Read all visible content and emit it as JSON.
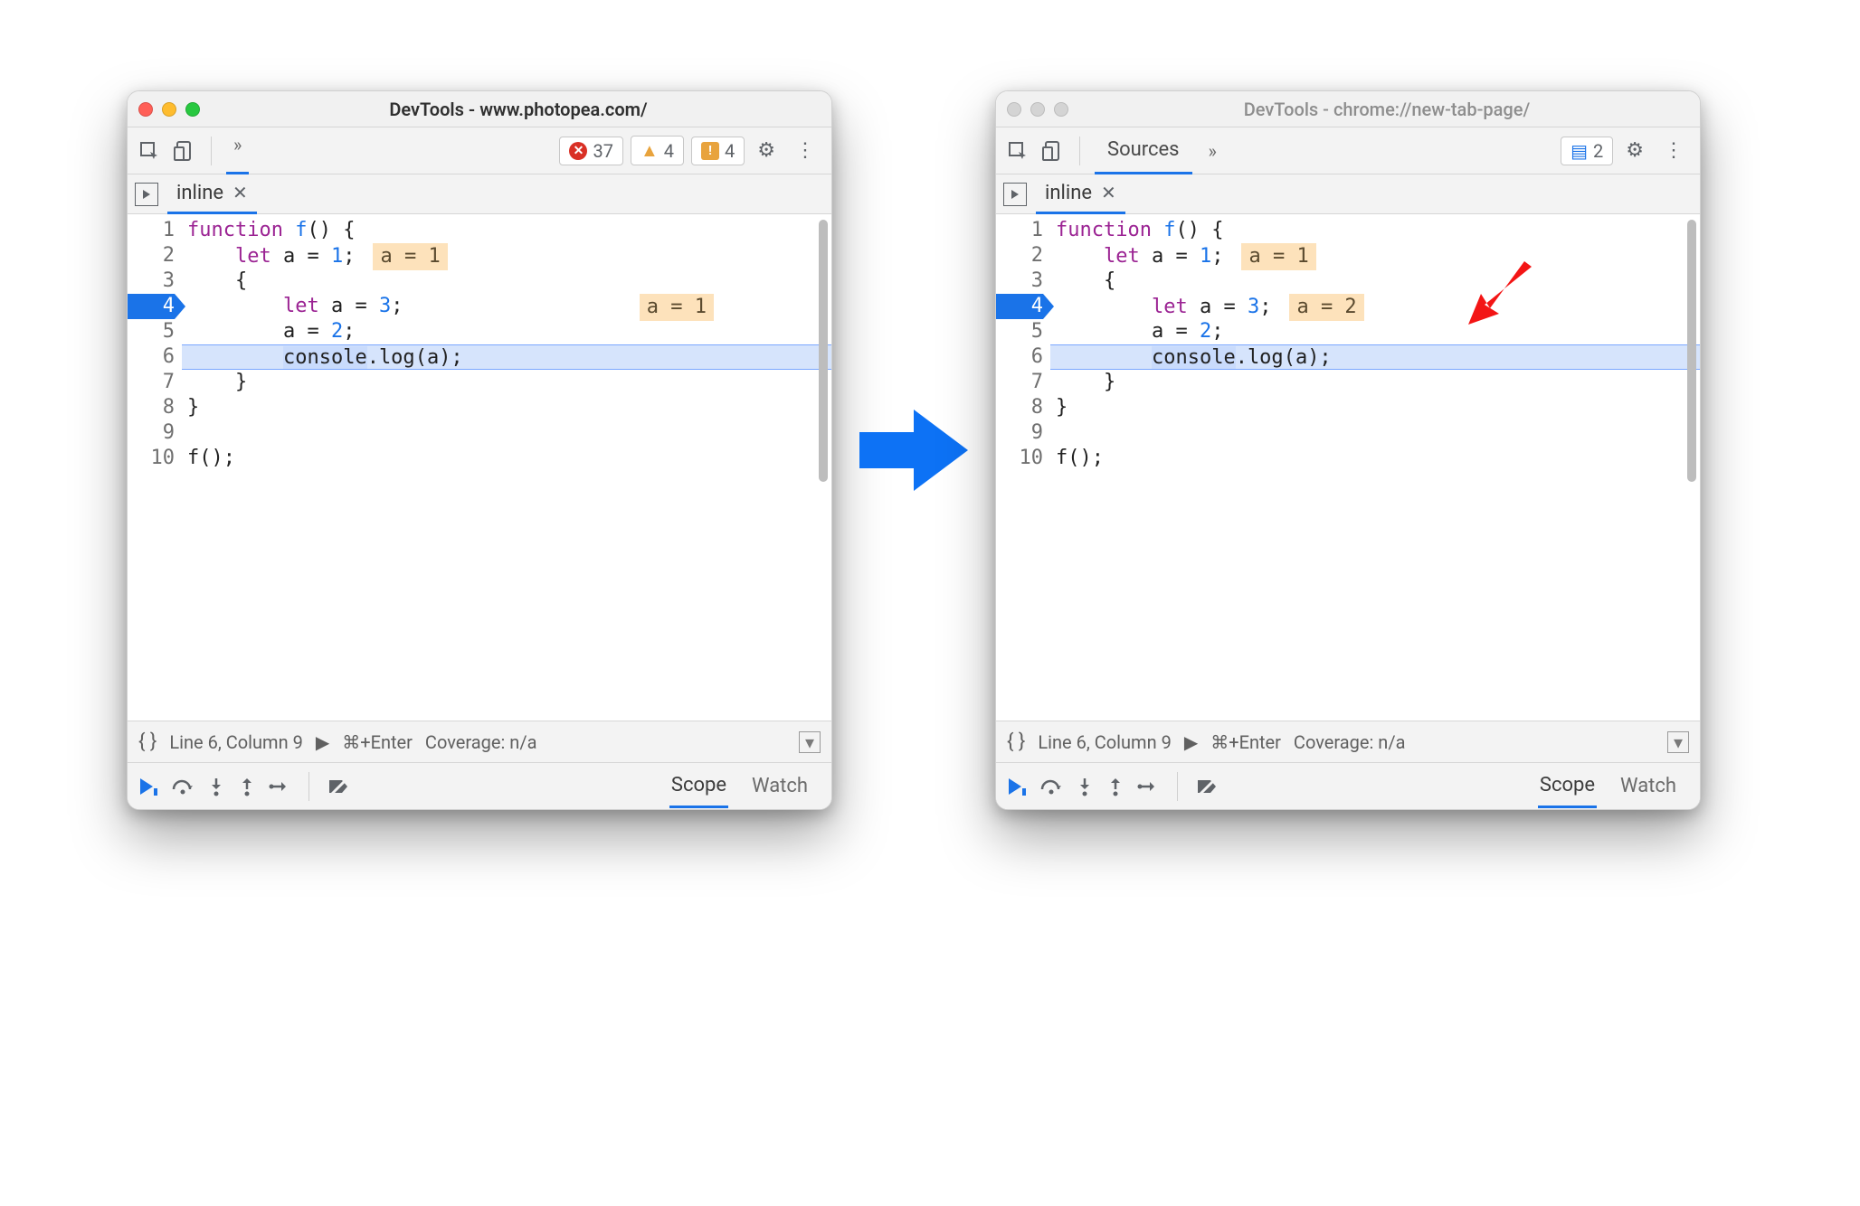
{
  "left": {
    "title": "DevTools - www.photopea.com/",
    "active": true,
    "toolbar": {
      "show_tab_label": false,
      "chips": {
        "err": "37",
        "warn": "4",
        "issue": "4"
      }
    },
    "filetab": {
      "name": "inline"
    },
    "code": {
      "breakpoint_line": 4,
      "exec_line": 6,
      "lines": [
        {
          "n": 1,
          "tokens": [
            {
              "t": "function ",
              "c": "kw"
            },
            {
              "t": "f",
              "c": "var"
            },
            {
              "t": "() {",
              "c": ""
            }
          ]
        },
        {
          "n": 2,
          "tokens": [
            {
              "t": "    ",
              "c": ""
            },
            {
              "t": "let ",
              "c": "kw"
            },
            {
              "t": "a",
              "c": "obj"
            },
            {
              "t": " = ",
              "c": ""
            },
            {
              "t": "1",
              "c": "num"
            },
            {
              "t": ";",
              "c": ""
            }
          ],
          "hint": "a = 1"
        },
        {
          "n": 3,
          "tokens": [
            {
              "t": "    {",
              "c": ""
            }
          ]
        },
        {
          "n": 4,
          "tokens": [
            {
              "t": "        ",
              "c": ""
            },
            {
              "t": "let ",
              "c": "kw"
            },
            {
              "t": "a",
              "c": "obj"
            },
            {
              "t": " = ",
              "c": ""
            },
            {
              "t": "3",
              "c": "num"
            },
            {
              "t": ";",
              "c": ""
            }
          ],
          "hint": "a = 1",
          "hint_far": true
        },
        {
          "n": 5,
          "tokens": [
            {
              "t": "        ",
              "c": ""
            },
            {
              "t": "a",
              "c": "obj"
            },
            {
              "t": " = ",
              "c": ""
            },
            {
              "t": "2",
              "c": "num"
            },
            {
              "t": ";",
              "c": ""
            }
          ]
        },
        {
          "n": 6,
          "tokens": [
            {
              "t": "        ",
              "c": ""
            },
            {
              "t": "console",
              "c": "sel"
            },
            {
              "t": ".",
              "c": ""
            },
            {
              "t": "log",
              "c": "obj"
            },
            {
              "t": "(",
              "c": ""
            },
            {
              "t": "a",
              "c": "obj"
            },
            {
              "t": ");",
              "c": ""
            }
          ]
        },
        {
          "n": 7,
          "tokens": [
            {
              "t": "    }",
              "c": ""
            }
          ]
        },
        {
          "n": 8,
          "tokens": [
            {
              "t": "}",
              "c": ""
            }
          ]
        },
        {
          "n": 9,
          "tokens": [
            {
              "t": "",
              "c": ""
            }
          ]
        },
        {
          "n": 10,
          "tokens": [
            {
              "t": "f",
              "c": "obj"
            },
            {
              "t": "();",
              "c": ""
            }
          ]
        }
      ]
    },
    "status": {
      "pos": "Line 6, Column 9",
      "run": "⌘+Enter",
      "cov": "Coverage: n/a"
    },
    "panes": {
      "active": "Scope",
      "inactive": "Watch"
    }
  },
  "right": {
    "title": "DevTools - chrome://new-tab-page/",
    "active": false,
    "toolbar": {
      "show_tab_label": true,
      "tab_label": "Sources",
      "chips": {
        "msg": "2"
      }
    },
    "filetab": {
      "name": "inline"
    },
    "code": {
      "breakpoint_line": 4,
      "exec_line": 6,
      "lines": [
        {
          "n": 1,
          "tokens": [
            {
              "t": "function ",
              "c": "kw"
            },
            {
              "t": "f",
              "c": "var"
            },
            {
              "t": "() {",
              "c": ""
            }
          ]
        },
        {
          "n": 2,
          "tokens": [
            {
              "t": "    ",
              "c": ""
            },
            {
              "t": "let ",
              "c": "kw"
            },
            {
              "t": "a",
              "c": "obj"
            },
            {
              "t": " = ",
              "c": ""
            },
            {
              "t": "1",
              "c": "num"
            },
            {
              "t": ";",
              "c": ""
            }
          ],
          "hint": "a = 1"
        },
        {
          "n": 3,
          "tokens": [
            {
              "t": "    {",
              "c": ""
            }
          ]
        },
        {
          "n": 4,
          "tokens": [
            {
              "t": "        ",
              "c": ""
            },
            {
              "t": "let ",
              "c": "kw"
            },
            {
              "t": "a",
              "c": "obj"
            },
            {
              "t": " = ",
              "c": ""
            },
            {
              "t": "3",
              "c": "num"
            },
            {
              "t": ";",
              "c": ""
            }
          ],
          "hint": "a = 2"
        },
        {
          "n": 5,
          "tokens": [
            {
              "t": "        ",
              "c": ""
            },
            {
              "t": "a",
              "c": "obj"
            },
            {
              "t": " = ",
              "c": ""
            },
            {
              "t": "2",
              "c": "num"
            },
            {
              "t": ";",
              "c": ""
            }
          ]
        },
        {
          "n": 6,
          "tokens": [
            {
              "t": "        ",
              "c": ""
            },
            {
              "t": "console",
              "c": "sel"
            },
            {
              "t": ".",
              "c": ""
            },
            {
              "t": "log",
              "c": "obj"
            },
            {
              "t": "(",
              "c": ""
            },
            {
              "t": "a",
              "c": "obj"
            },
            {
              "t": ");",
              "c": ""
            }
          ]
        },
        {
          "n": 7,
          "tokens": [
            {
              "t": "    }",
              "c": ""
            }
          ]
        },
        {
          "n": 8,
          "tokens": [
            {
              "t": "}",
              "c": ""
            }
          ]
        },
        {
          "n": 9,
          "tokens": [
            {
              "t": "",
              "c": ""
            }
          ]
        },
        {
          "n": 10,
          "tokens": [
            {
              "t": "f",
              "c": "obj"
            },
            {
              "t": "();",
              "c": ""
            }
          ]
        }
      ]
    },
    "status": {
      "pos": "Line 6, Column 9",
      "run": "⌘+Enter",
      "cov": "Coverage: n/a"
    },
    "panes": {
      "active": "Scope",
      "inactive": "Watch"
    }
  }
}
